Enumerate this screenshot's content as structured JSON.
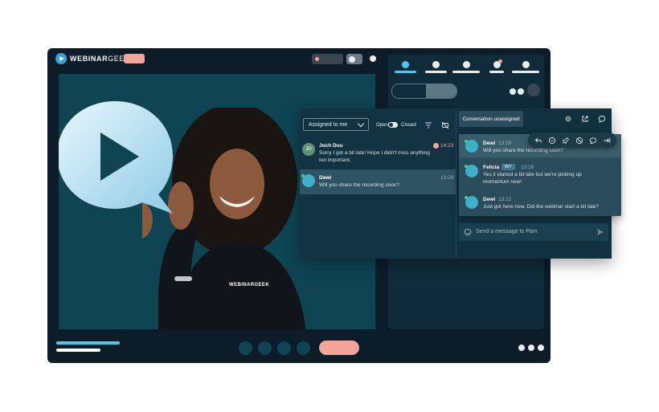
{
  "app": {
    "logo_text": "WEBINAR",
    "logo_text_2": "GEEK"
  },
  "stage": {
    "shirt_logo": "WEBINARGEEK"
  },
  "chat": {
    "filter_label": "Assigned to me",
    "open_label": "Open",
    "closed_label": "Closed",
    "conversation_status": "Conversation unassigned",
    "conversations": [
      {
        "initials": "JD",
        "name": "Joch Dou",
        "time": "14:23",
        "message": "Sorry I got a bit late! Hope I didn't miss anything too important.",
        "flagged": true
      },
      {
        "initials": "",
        "name": "Dewi",
        "time": "13:29",
        "message": "Will you share the recording soon?",
        "selected": true
      }
    ],
    "thread": [
      {
        "name": "Dewi",
        "time": "13:29",
        "message": "Will you share the recording soon?"
      },
      {
        "name": "Felicia",
        "badge": "WT",
        "time": "13:26",
        "message": "Yes it started a bit late but we're picking up momentum now!"
      },
      {
        "name": "Dewi",
        "time": "13:22",
        "message": "Just got here now. Did the webinar start a bit late?"
      }
    ],
    "input_placeholder": "Send a message to Pam"
  },
  "colors": {
    "accent": "#4fc7e8",
    "salmon": "#f3a59a",
    "app_bg": "#0c1d29",
    "stage_bg": "#0f4453",
    "chat_bg": "#11313f"
  },
  "icons": [
    "play-logo-icon",
    "filter-icon",
    "mute-notification-icon",
    "settings-icon",
    "open-external-icon",
    "chat-icon",
    "reply-icon",
    "comment-icon",
    "pin-icon",
    "block-icon",
    "speech-bubble-icon",
    "forward-icon",
    "emoji-icon",
    "send-icon"
  ]
}
